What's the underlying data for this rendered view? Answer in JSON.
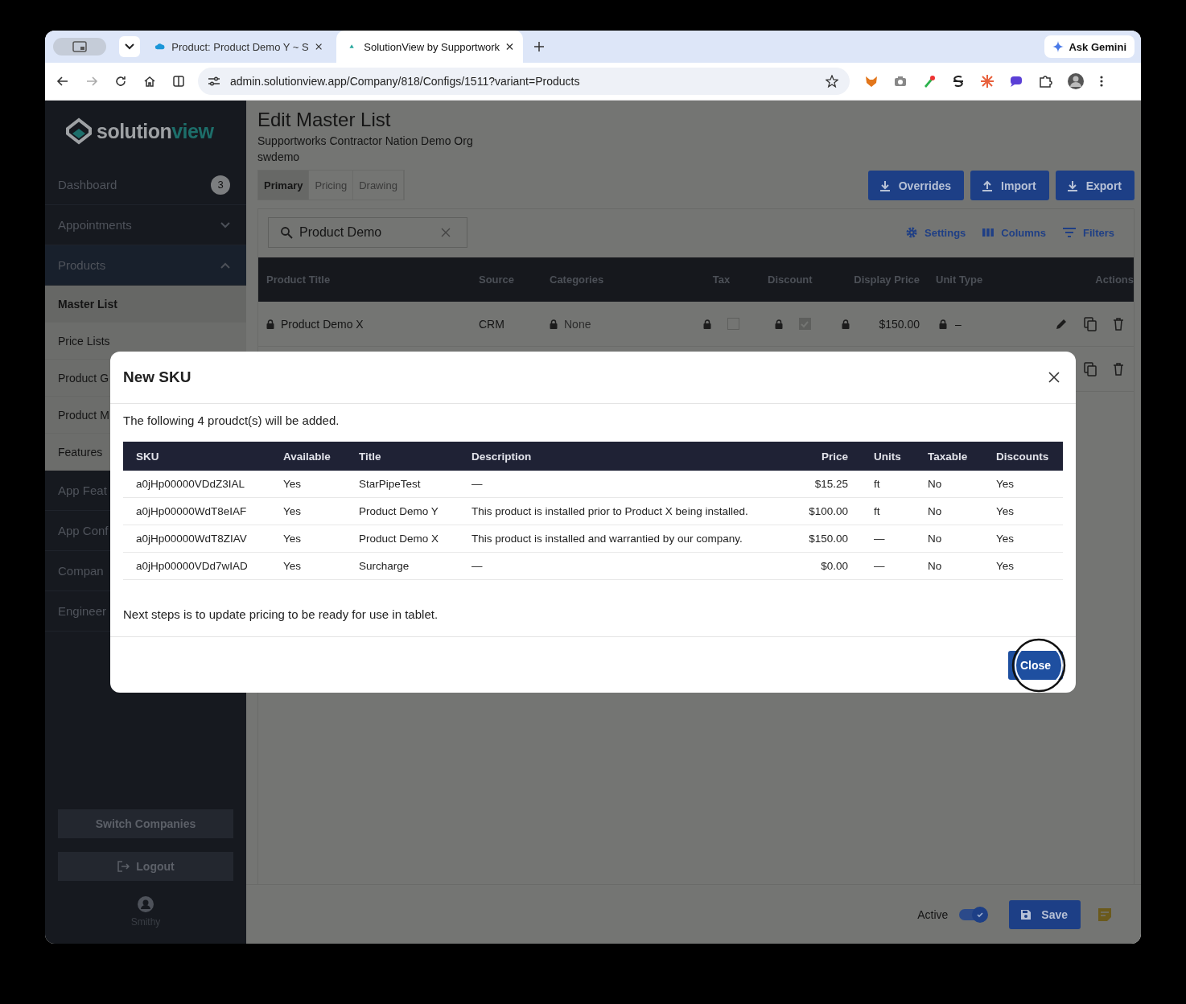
{
  "browser": {
    "tabs": [
      {
        "title": "Product: Product Demo Y ~ S",
        "selected": false
      },
      {
        "title": "SolutionView by Supportwork",
        "selected": true
      }
    ],
    "gemini": "Ask Gemini",
    "url": "admin.solutionview.app/Company/818/Configs/1511?variant=Products"
  },
  "sidebar": {
    "logo": {
      "first": "solution",
      "second": "view"
    },
    "items": [
      {
        "label": "Dashboard",
        "kind": "link",
        "badge": "3"
      },
      {
        "label": "Appointments",
        "kind": "group",
        "expanded": false
      },
      {
        "label": "Products",
        "kind": "group",
        "expanded": true,
        "children": [
          {
            "label": "Master List",
            "selected": true
          },
          {
            "label": "Price Lists",
            "selected": false
          },
          {
            "label": "Product G",
            "selected": false
          },
          {
            "label": "Product M",
            "selected": false
          },
          {
            "label": "Features",
            "selected": false
          }
        ]
      },
      {
        "label": "App Feat",
        "kind": "link"
      },
      {
        "label": "App Conf",
        "kind": "link"
      },
      {
        "label": "Compan",
        "kind": "link"
      },
      {
        "label": "Engineer",
        "kind": "link"
      }
    ],
    "switch": "Switch Companies",
    "logout": "Logout",
    "user": "Smithy"
  },
  "page": {
    "title": "Edit Master List",
    "subtitle": "Supportworks Contractor Nation Demo Org",
    "code": "swdemo",
    "tabs": [
      {
        "label": "Primary",
        "selected": true
      },
      {
        "label": "Pricing",
        "selected": false
      },
      {
        "label": "Drawing",
        "selected": false
      }
    ],
    "actions": [
      {
        "label": "Overrides",
        "kind": "download"
      },
      {
        "label": "Import",
        "kind": "upload"
      },
      {
        "label": "Export",
        "kind": "download"
      }
    ],
    "search": {
      "value": "Product Demo"
    },
    "tools": [
      {
        "label": "Settings",
        "kind": "gear"
      },
      {
        "label": "Columns",
        "kind": "columns"
      },
      {
        "label": "Filters",
        "kind": "filter"
      }
    ],
    "table": {
      "columns": [
        "Product Title",
        "Source",
        "Categories",
        "Tax",
        "Discount",
        "Display Price",
        "Unit Type",
        "Actions"
      ],
      "rows": [
        {
          "kind": "full",
          "title": "Product Demo X",
          "source": "CRM",
          "categories": "None",
          "tax": false,
          "discount": true,
          "display_price": "$150.00",
          "unit_type": "–"
        },
        {
          "kind": "covered"
        }
      ]
    }
  },
  "footer": {
    "active_label": "Active",
    "active": true,
    "save": "Save"
  },
  "modal": {
    "title": "New SKU",
    "intro": "The following 4 proudct(s) will be added.",
    "columns": [
      "SKU",
      "Available",
      "Title",
      "Description",
      "Price",
      "Units",
      "Taxable",
      "Discounts"
    ],
    "rows": [
      [
        "a0jHp00000VDdZ3IAL",
        "Yes",
        "StarPipeTest",
        "—",
        "$15.25",
        "ft",
        "No",
        "Yes"
      ],
      [
        "a0jHp00000WdT8eIAF",
        "Yes",
        "Product Demo Y",
        "This product is installed prior to Product X being installed.",
        "$100.00",
        "ft",
        "No",
        "Yes"
      ],
      [
        "a0jHp00000WdT8ZIAV",
        "Yes",
        "Product Demo X",
        "This product is installed and warrantied by our company.",
        "$150.00",
        "—",
        "No",
        "Yes"
      ],
      [
        "a0jHp00000VDd7wIAD",
        "Yes",
        "Surcharge",
        "—",
        "$0.00",
        "—",
        "No",
        "Yes"
      ]
    ],
    "note": "Next steps is to update pricing to be ready for use in tablet.",
    "close": "Close"
  }
}
